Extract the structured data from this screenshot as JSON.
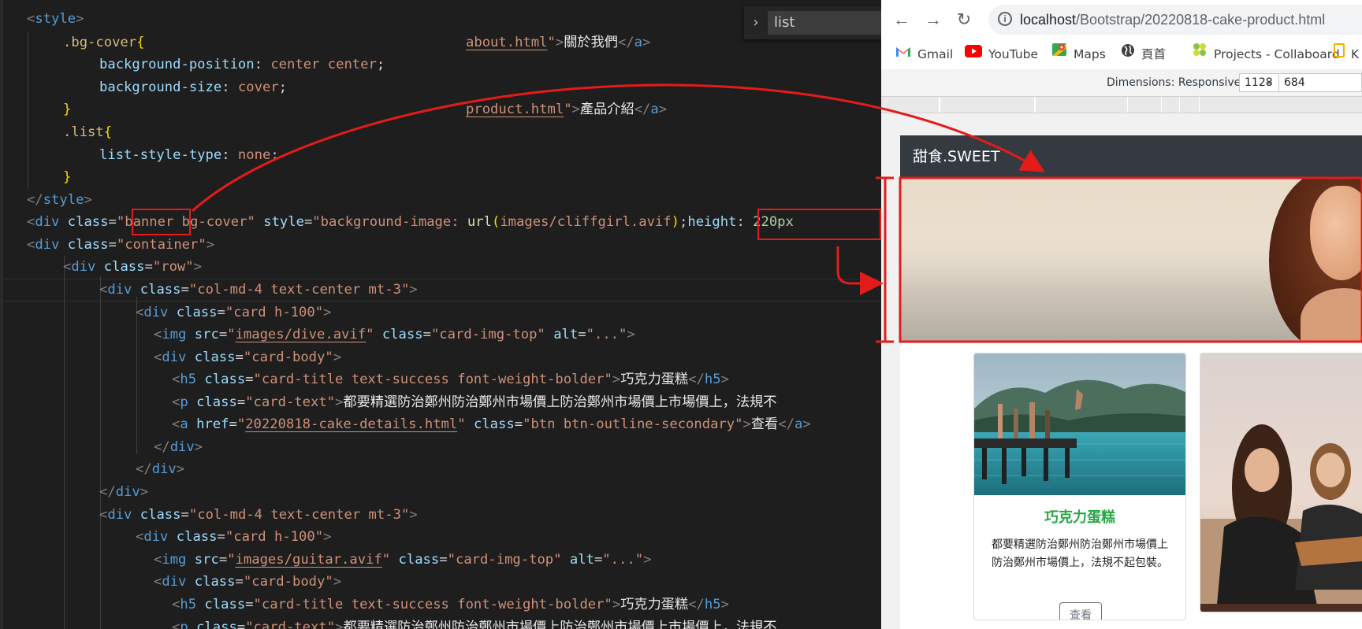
{
  "editor": {
    "find": {
      "query": "list"
    },
    "lines": {
      "style_open": "<style>",
      "bg_cover_selector": ".bg-cover",
      "bg_position_prop": "background-position",
      "bg_position_val": "center center",
      "bg_size_prop": "background-size",
      "bg_size_val": "cover",
      "list_selector": ".list",
      "list_style_prop": "list-style-type",
      "list_style_val": "none",
      "style_close": "</style>",
      "about_href": "about.html",
      "about_text": "關於我們",
      "product_href": "product.html",
      "product_text": "產品介紹",
      "banner_class_a": "banner",
      "banner_class_b": " bg-cover",
      "banner_bg_url": "images/cliffgirl.avif",
      "banner_height_prop": "height",
      "banner_height_val": "220px",
      "container_class": "container",
      "row_class": "row",
      "col_class": "col-md-4 text-center mt-3",
      "card_class": "card h-100",
      "img1_src": "images/dive.avif",
      "img_class": "card-img-top",
      "img_alt": "...",
      "card_body_class": "card-body",
      "h5_class": "card-title text-success font-weight-bolder",
      "h5_text": "巧克力蛋糕",
      "p_class": "card-text",
      "p_text": "都要精選防治鄭州防治鄭州市場價上防治鄭州市場價上市場價上，法規不",
      "a_href": "20220818-cake-details.html",
      "a_class": "btn btn-outline-secondary",
      "a_text": "查看",
      "img2_src": "images/guitar.avif"
    }
  },
  "browser": {
    "url_host": "localhost",
    "url_path": "/Bootstrap/20220818-cake-product.html",
    "bookmarks": [
      {
        "label": "Gmail",
        "icon": "gmail-icon"
      },
      {
        "label": "YouTube",
        "icon": "youtube-icon"
      },
      {
        "label": "Maps",
        "icon": "maps-icon"
      },
      {
        "label": "頁首",
        "icon": "globe-icon"
      },
      {
        "label": "Projects - Collaboard",
        "icon": "collaboard-icon"
      },
      {
        "label": "K",
        "icon": "bookmark-icon"
      }
    ],
    "devtools": {
      "dimensions_label": "Dimensions: Responsive ▼",
      "width": "1128",
      "height": "684"
    },
    "page": {
      "brand": "甜食.SWEET",
      "cards": [
        {
          "title": "巧克力蛋糕",
          "text": "都要精選防治鄭州防治鄭州市場價上防治鄭州市場價上，法規不起包裝。",
          "button": "查看"
        }
      ]
    }
  },
  "colors": {
    "annotation_red": "#e41b1b",
    "success_green": "#28a745",
    "navbar_dark": "#343a40"
  }
}
